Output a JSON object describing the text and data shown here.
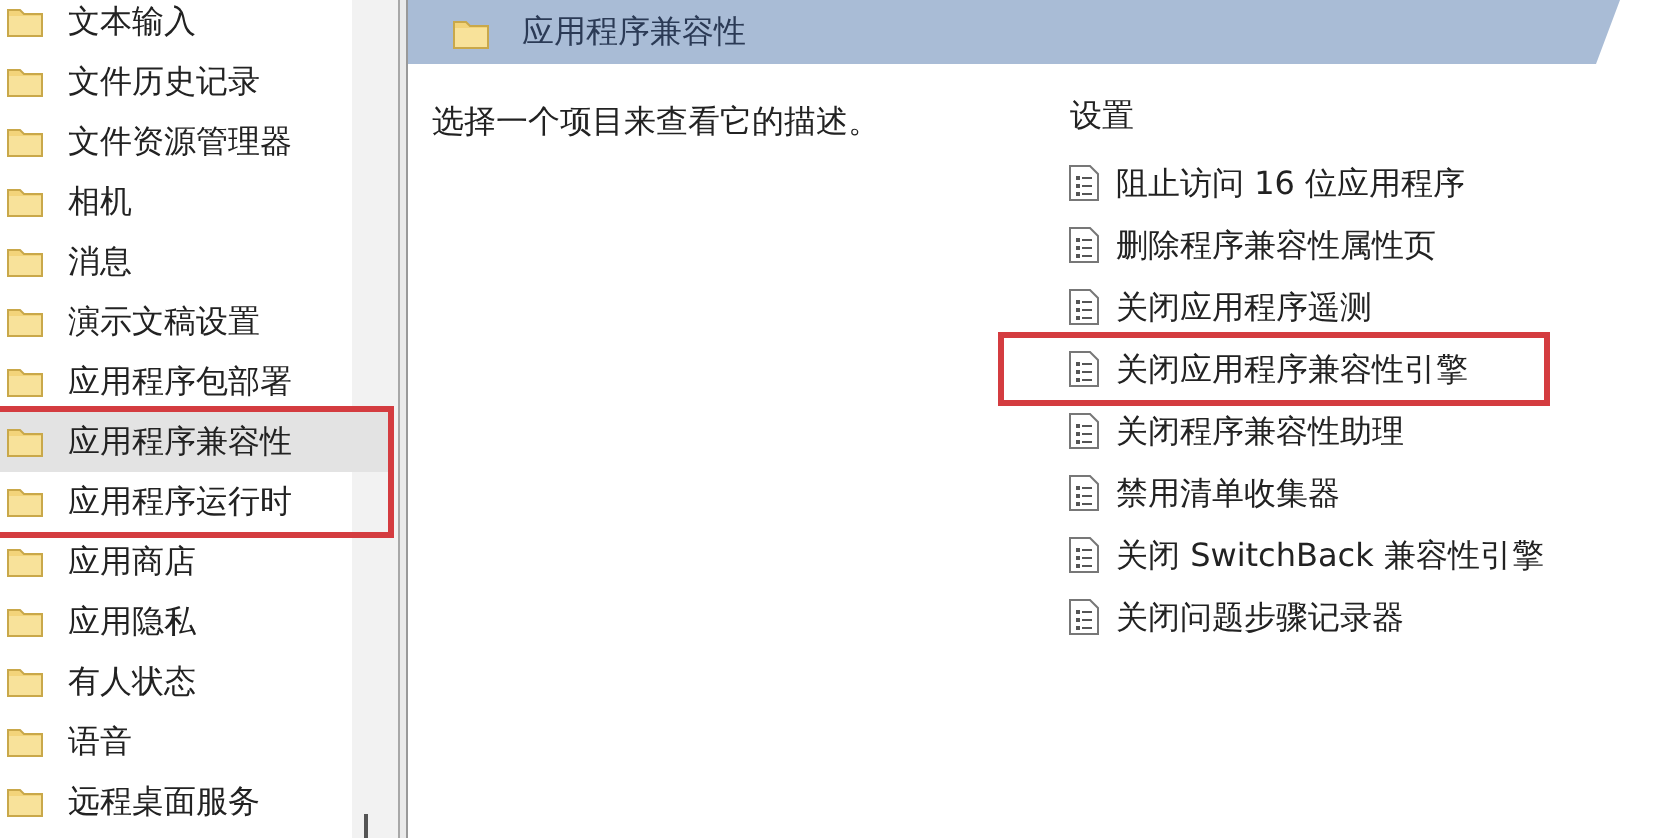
{
  "sidebar": {
    "items": [
      {
        "label": "文本输入",
        "selected": false,
        "boxed": false
      },
      {
        "label": "文件历史记录",
        "selected": false,
        "boxed": false
      },
      {
        "label": "文件资源管理器",
        "selected": false,
        "boxed": false
      },
      {
        "label": "相机",
        "selected": false,
        "boxed": false
      },
      {
        "label": "消息",
        "selected": false,
        "boxed": false
      },
      {
        "label": "演示文稿设置",
        "selected": false,
        "boxed": false
      },
      {
        "label": "应用程序包部署",
        "selected": false,
        "boxed": false
      },
      {
        "label": "应用程序兼容性",
        "selected": true,
        "boxed": true
      },
      {
        "label": "应用程序运行时",
        "selected": false,
        "boxed": true
      },
      {
        "label": "应用商店",
        "selected": false,
        "boxed": false
      },
      {
        "label": "应用隐私",
        "selected": false,
        "boxed": false
      },
      {
        "label": "有人状态",
        "selected": false,
        "boxed": false
      },
      {
        "label": "语音",
        "selected": false,
        "boxed": false
      },
      {
        "label": "远程桌面服务",
        "selected": false,
        "boxed": false
      }
    ]
  },
  "pane": {
    "title": "应用程序兼容性",
    "description": "选择一个项目来查看它的描述。",
    "settings_heading": "设置",
    "settings": [
      {
        "label": "阻止访问 16 位应用程序",
        "boxed": false
      },
      {
        "label": "删除程序兼容性属性页",
        "boxed": false
      },
      {
        "label": "关闭应用程序遥测",
        "boxed": false
      },
      {
        "label": "关闭应用程序兼容性引擎",
        "boxed": true
      },
      {
        "label": "关闭程序兼容性助理",
        "boxed": false
      },
      {
        "label": "禁用清单收集器",
        "boxed": false
      },
      {
        "label": "关闭 SwitchBack 兼容性引擎",
        "boxed": false
      },
      {
        "label": "关闭问题步骤记录器",
        "boxed": false
      }
    ]
  }
}
